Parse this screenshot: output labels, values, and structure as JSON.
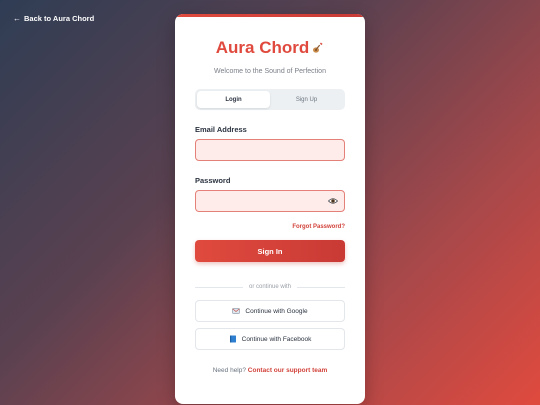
{
  "nav": {
    "back_arrow": "←",
    "back_label": "Back to Aura Chord"
  },
  "brand": {
    "name": "Aura Chord",
    "icon": "guitar-icon"
  },
  "tagline": "Welcome to the Sound of Perfection",
  "tabs": [
    {
      "label": "Login",
      "active": true
    },
    {
      "label": "Sign Up",
      "active": false
    }
  ],
  "form": {
    "email_label": "Email Address",
    "email_value": "",
    "password_label": "Password",
    "password_value": "",
    "forgot_label": "Forgot Password?",
    "submit_label": "Sign In"
  },
  "divider_text": "or continue with",
  "social": [
    {
      "label": "Continue with Google",
      "icon": "envelope-icon"
    },
    {
      "label": "Continue with Facebook",
      "icon": "blue-book-icon"
    }
  ],
  "help": {
    "prefix": "Need help?",
    "link": "Contact our support team"
  },
  "colors": {
    "accent": "#e04a3e",
    "field_bg": "#fdecea",
    "field_border": "#e58078"
  }
}
